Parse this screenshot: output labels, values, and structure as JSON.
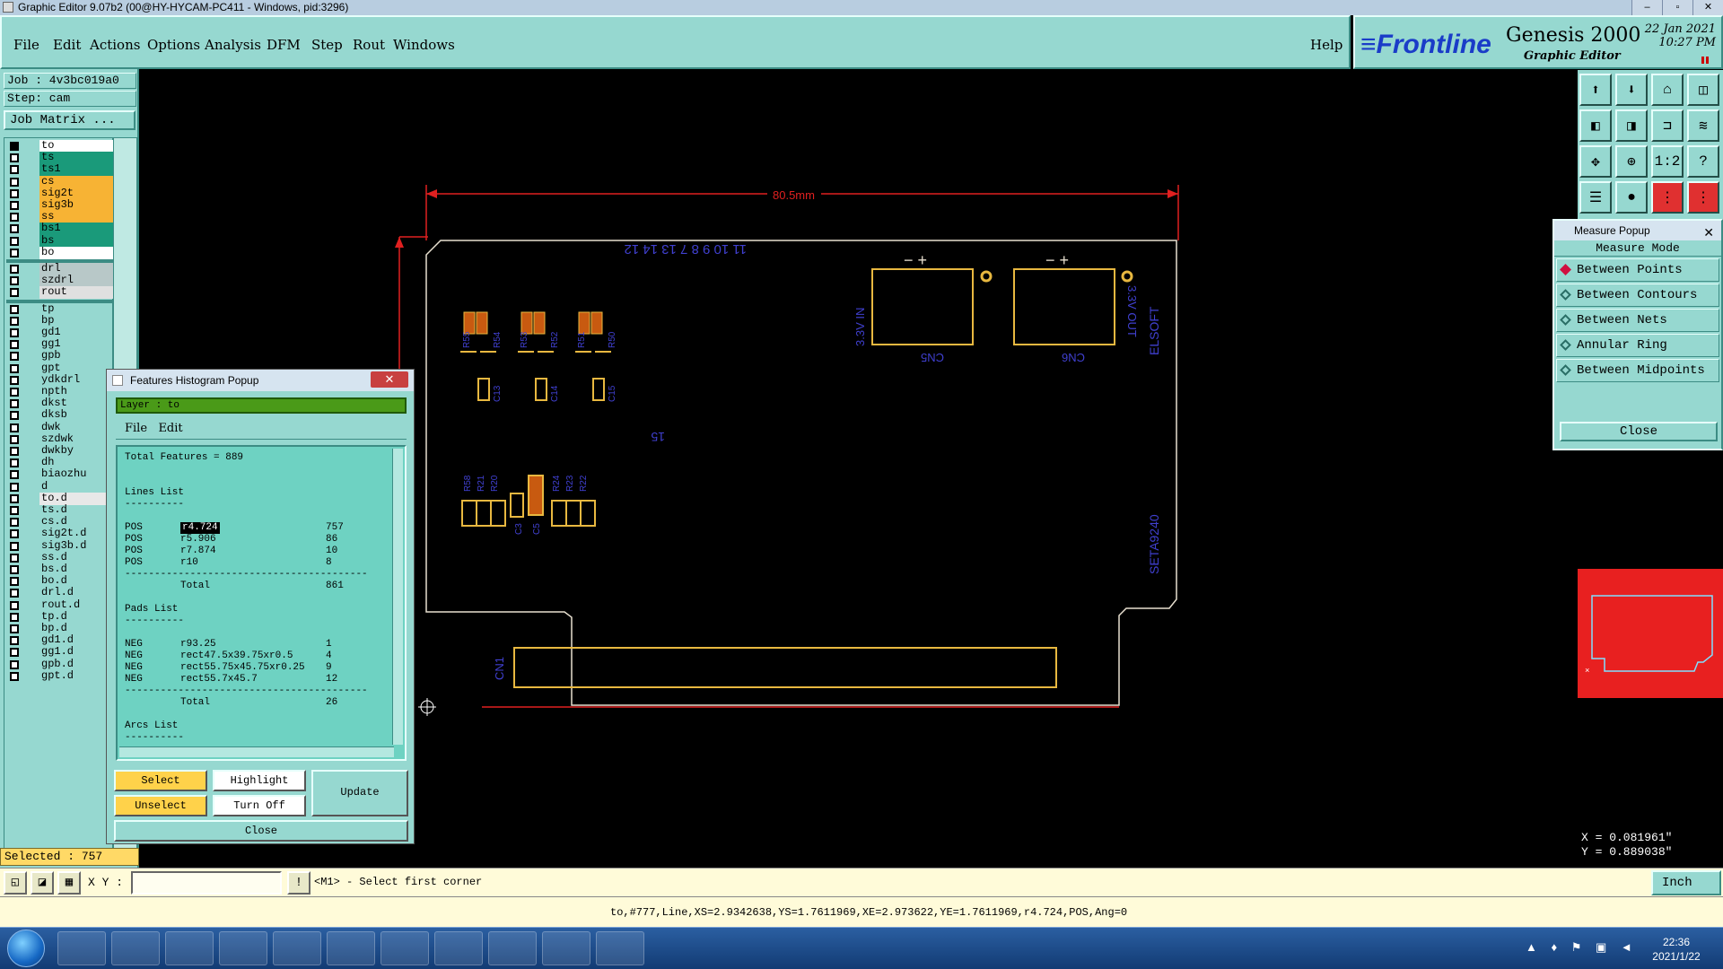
{
  "window": {
    "title": "Graphic Editor 9.07b2 (00@HY-HYCAM-PC411 - Windows, pid:3296)"
  },
  "menu": {
    "items": [
      "File",
      "Edit",
      "Actions",
      "Options",
      "Analysis",
      "DFM",
      "Step",
      "Rout",
      "Windows"
    ],
    "help": "Help"
  },
  "brand": {
    "logo_front": "≡Frontline",
    "product": "Genesis 2000",
    "subtitle": "Graphic Editor",
    "date": "22 Jan 2021",
    "time": "10:27 PM"
  },
  "job": {
    "job_label": "Job : 4v3bc019a0",
    "step_label": "Step: cam",
    "matrix_button": "Job Matrix ..."
  },
  "layers": {
    "group1": [
      {
        "name": "to",
        "color": "#ffffff",
        "active": true
      },
      {
        "name": "ts",
        "color": "#1a9a7a"
      },
      {
        "name": "ts1",
        "color": "#1a9a7a"
      },
      {
        "name": "cs",
        "color": "#f7b334"
      },
      {
        "name": "sig2t",
        "color": "#f7b334"
      },
      {
        "name": "sig3b",
        "color": "#f7b334"
      },
      {
        "name": "ss",
        "color": "#f7b334"
      },
      {
        "name": "bs1",
        "color": "#1a9a7a"
      },
      {
        "name": "bs",
        "color": "#1a9a7a"
      },
      {
        "name": "bo",
        "color": "#ffffff"
      }
    ],
    "group2": [
      {
        "name": "drl",
        "color": "#b8c8c8"
      },
      {
        "name": "szdrl",
        "color": "#b8c8c8"
      },
      {
        "name": "rout",
        "color": "#e0e0e0"
      }
    ],
    "group3": [
      "tp",
      "bp",
      "gd1",
      "gg1",
      "gpb",
      "gpt",
      "ydkdrl",
      "npth",
      "dkst",
      "dksb",
      "dwk",
      "szdwk",
      "dwkby",
      "dh",
      "biaozhu",
      "d",
      "to.d",
      "ts.d",
      "cs.d",
      "sig2t.d",
      "sig3b.d",
      "ss.d",
      "bs.d",
      "bo.d",
      "drl.d",
      "rout.d",
      "tp.d",
      "bp.d",
      "gd1.d",
      "gg1.d",
      "gpb.d",
      "gpt.d"
    ]
  },
  "selected_label": "Selected : 757",
  "canvas": {
    "dimension": "80.5mm",
    "labels": [
      "11 10 9 8 7 13 14 12",
      "3.3V IN",
      "3.3V OUT",
      "CN5",
      "CN6",
      "ELSOFT",
      "SETA9240",
      "CN1",
      "15",
      "C13",
      "C14",
      "C15",
      "C3",
      "C5",
      "R58",
      "R21",
      "R20",
      "R24",
      "R23",
      "R22",
      "R55",
      "R54",
      "R53",
      "R52",
      "R51",
      "R50"
    ]
  },
  "measure": {
    "title": "Measure Popup",
    "heading": "Measure Mode",
    "options": [
      "Between Points",
      "Between Contours",
      "Between Nets",
      "Annular Ring",
      "Between Midpoints"
    ],
    "close": "Close"
  },
  "coords": {
    "x": "X = 0.081961\"",
    "y": "Y = 0.889038\""
  },
  "histogram": {
    "title": "Features Histogram Popup",
    "layer_label": "Layer : to",
    "menu": [
      "File",
      "Edit"
    ],
    "total": "Total Features = 889",
    "lines_header": "Lines List",
    "dashes_short": "----------",
    "lines": [
      {
        "pol": "POS",
        "sym": "r4.724",
        "count": "757",
        "sel": true
      },
      {
        "pol": "POS",
        "sym": "r5.906",
        "count": "86"
      },
      {
        "pol": "POS",
        "sym": "r7.874",
        "count": "10"
      },
      {
        "pol": "POS",
        "sym": "r10",
        "count": "8"
      }
    ],
    "lines_total_label": "Total",
    "lines_total": "861",
    "pads_header": "Pads List",
    "pads": [
      {
        "pol": "NEG",
        "sym": "r93.25",
        "count": "1"
      },
      {
        "pol": "NEG",
        "sym": "rect47.5x39.75xr0.5",
        "count": "4"
      },
      {
        "pol": "NEG",
        "sym": "rect55.75x45.75xr0.25",
        "count": "9"
      },
      {
        "pol": "NEG",
        "sym": "rect55.7x45.7",
        "count": "12"
      }
    ],
    "pads_total_label": "Total",
    "pads_total": "26",
    "arcs_header": "Arcs List",
    "dashes_long": "-----------------------------------------",
    "buttons": {
      "select": "Select",
      "highlight": "Highlight",
      "update": "Update",
      "unselect": "Unselect",
      "turn_off": "Turn Off",
      "close": "Close"
    }
  },
  "command": {
    "xy_label": "X Y :",
    "prompt": "<M1> - Select first corner",
    "units": "Inch"
  },
  "status": "to,#777,Line,XS=2.9342638,YS=1.7611969,XE=2.973622,YE=1.7611969,r4.724,POS,Ang=0",
  "taskbar": {
    "time": "22:36",
    "date": "2021/1/22"
  }
}
